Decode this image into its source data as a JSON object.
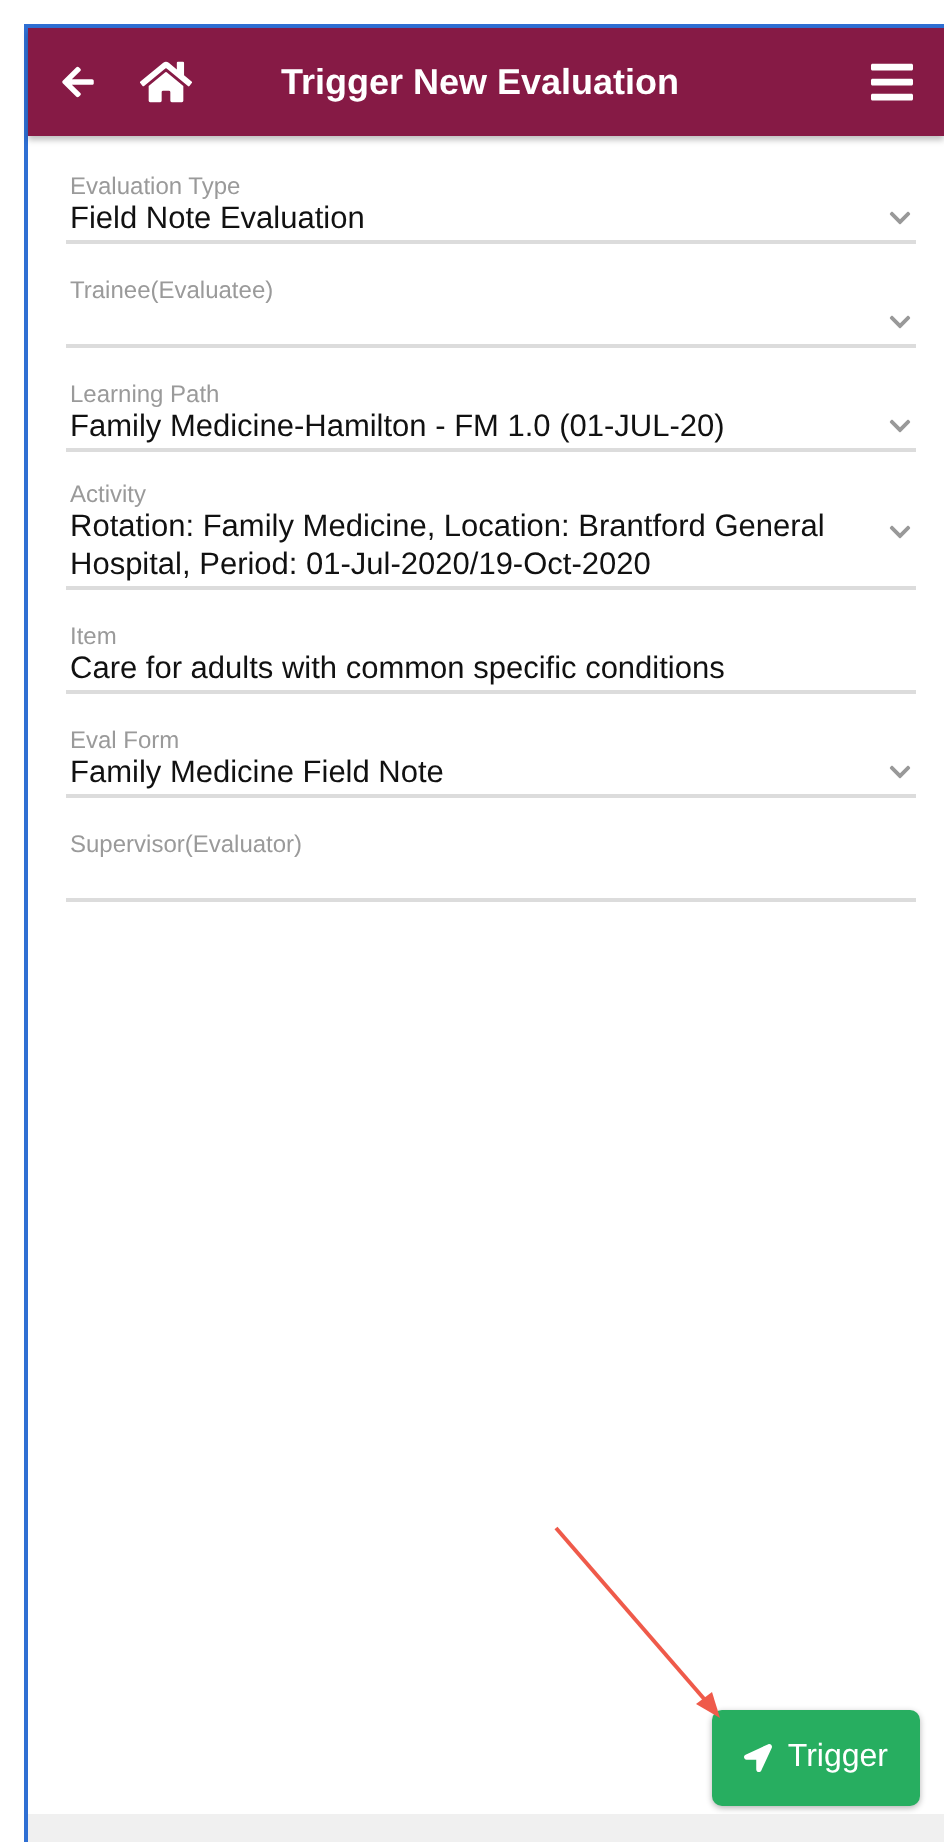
{
  "header": {
    "title": "Trigger New Evaluation"
  },
  "fields": [
    {
      "label": "Evaluation Type",
      "value": "Field Note Evaluation",
      "kind": "select"
    },
    {
      "label": "Trainee(Evaluatee)",
      "kind": "select"
    },
    {
      "label": "Learning Path",
      "value": "Family Medicine-Hamilton - FM 1.0 (01-JUL-20)",
      "kind": "select"
    },
    {
      "label": "Activity",
      "value": "Rotation: Family Medicine, Location: Brantford General Hospital, Period: 01-Jul-2020/19-Oct-2020",
      "kind": "select"
    },
    {
      "label": "Item",
      "value": "Care for adults with common specific conditions",
      "kind": "text"
    },
    {
      "label": "Eval Form",
      "value": "Family Medicine Field Note",
      "kind": "select"
    },
    {
      "label": "Supervisor(Evaluator)",
      "kind": "text"
    }
  ],
  "button": {
    "label": "Trigger"
  }
}
